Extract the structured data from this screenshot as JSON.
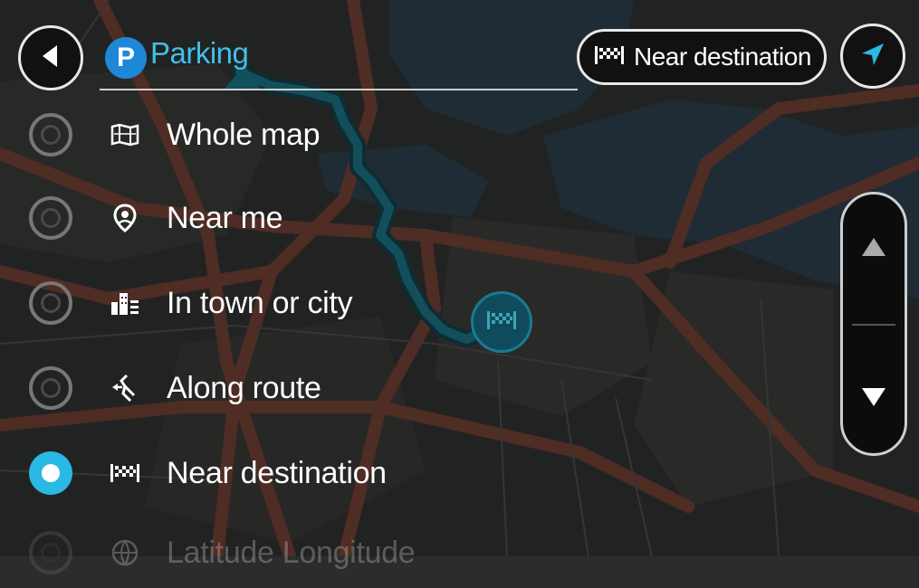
{
  "search": {
    "category_badge": "P",
    "query": "Parking"
  },
  "filter_pill": {
    "label": "Near destination",
    "icon": "checkered-flag-icon"
  },
  "options": [
    {
      "label": "Whole map",
      "icon": "whole-map-icon",
      "selected": false
    },
    {
      "label": "Near me",
      "icon": "location-pin-icon",
      "selected": false
    },
    {
      "label": "In town or city",
      "icon": "city-buildings-icon",
      "selected": false
    },
    {
      "label": "Along route",
      "icon": "along-route-icon",
      "selected": false
    },
    {
      "label": "Near destination",
      "icon": "checkered-flag-icon",
      "selected": true
    },
    {
      "label": "Latitude Longitude",
      "icon": "globe-icon",
      "selected": false
    }
  ],
  "colors": {
    "accent": "#2ab8e4",
    "route": "#1b6c7f",
    "badge": "#1e88d8",
    "background": "#2b2d2c"
  }
}
